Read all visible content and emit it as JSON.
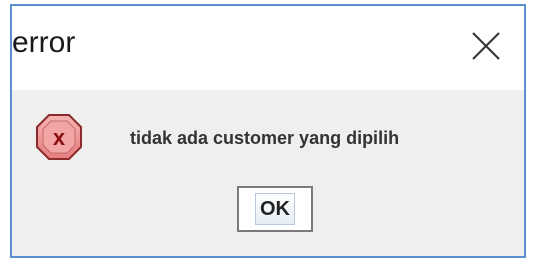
{
  "dialog": {
    "title": "error",
    "message": "tidak ada customer yang dipilih",
    "ok_label": "OK",
    "icon": "error-icon",
    "close_icon": "close-icon"
  },
  "colors": {
    "border": "#5a8fd0",
    "content_background": "#efefef",
    "error_red": "#e05050"
  }
}
